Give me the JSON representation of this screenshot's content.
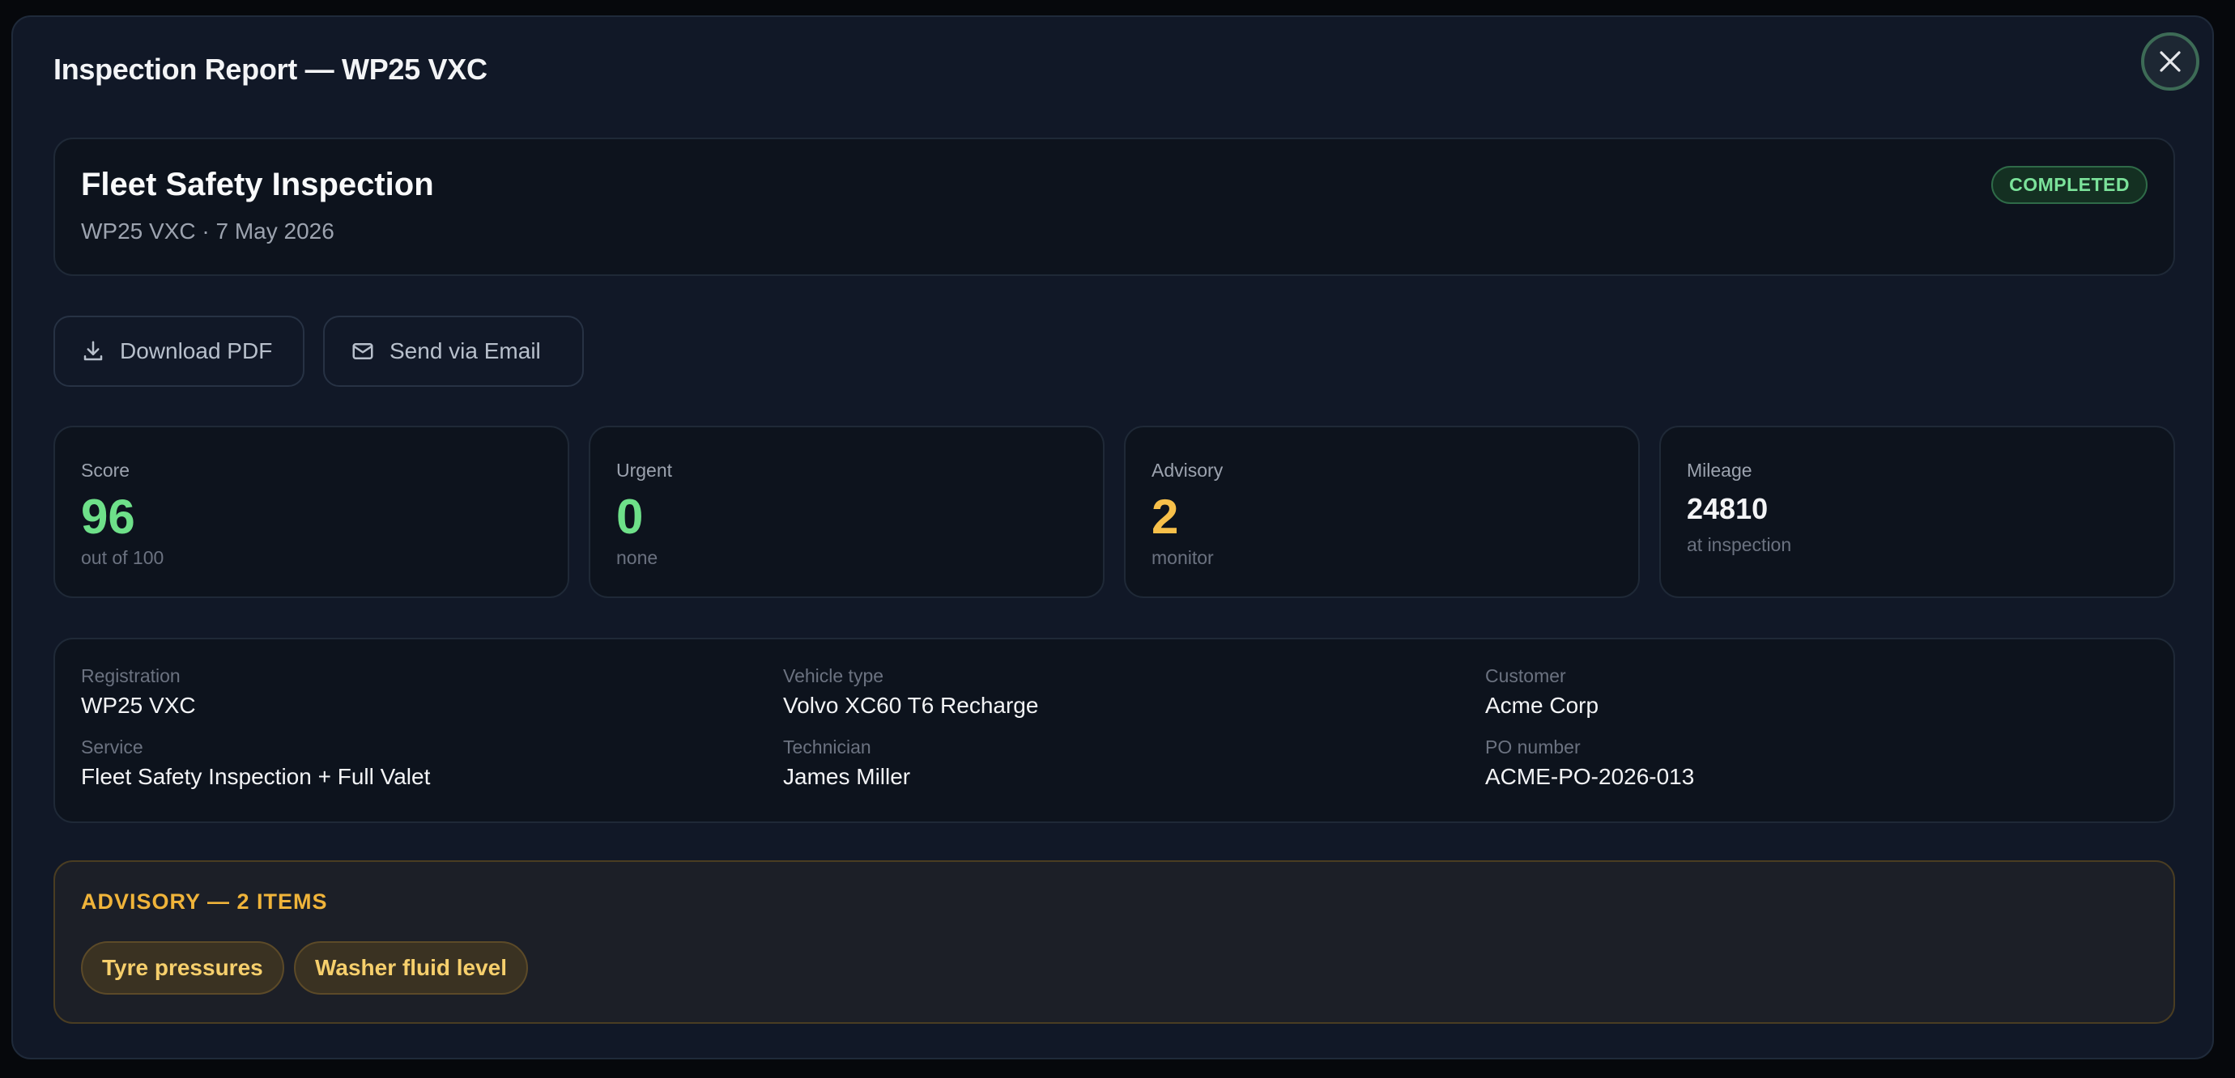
{
  "modal": {
    "title": "Inspection Report — WP25 VXC",
    "close_icon": "close-icon"
  },
  "header": {
    "title": "Fleet Safety Inspection",
    "subtitle": "WP25 VXC · 7 May 2026",
    "status": "COMPLETED",
    "status_color": "#7be29a"
  },
  "actions": {
    "download_label": "Download PDF",
    "download_icon": "download-icon",
    "email_label": "Send via Email",
    "email_icon": "mail-icon"
  },
  "stats": [
    {
      "label": "Score",
      "value": "96",
      "sub": "out of 100",
      "color": "#6ee089"
    },
    {
      "label": "Urgent",
      "value": "0",
      "sub": "none",
      "color": "#6ee089"
    },
    {
      "label": "Advisory",
      "value": "2",
      "sub": "monitor",
      "color": "#f7c04a"
    },
    {
      "label": "Mileage",
      "value": "24810",
      "sub": "at inspection",
      "color": "#f3f4f6"
    }
  ],
  "details": {
    "registration_label": "Registration",
    "registration": "WP25 VXC",
    "vehicle_type_label": "Vehicle type",
    "vehicle_type": "Volvo XC60 T6 Recharge",
    "customer_label": "Customer",
    "customer": "Acme Corp",
    "service_label": "Service",
    "service": "Fleet Safety Inspection + Full Valet",
    "technician_label": "Technician",
    "technician": "James Miller",
    "po_label": "PO number",
    "po": "ACME-PO-2026-013"
  },
  "advisory": {
    "title": "ADVISORY — 2 ITEMS",
    "items": [
      "Tyre pressures",
      "Washer fluid level"
    ],
    "accent_color": "#f0b43a"
  }
}
